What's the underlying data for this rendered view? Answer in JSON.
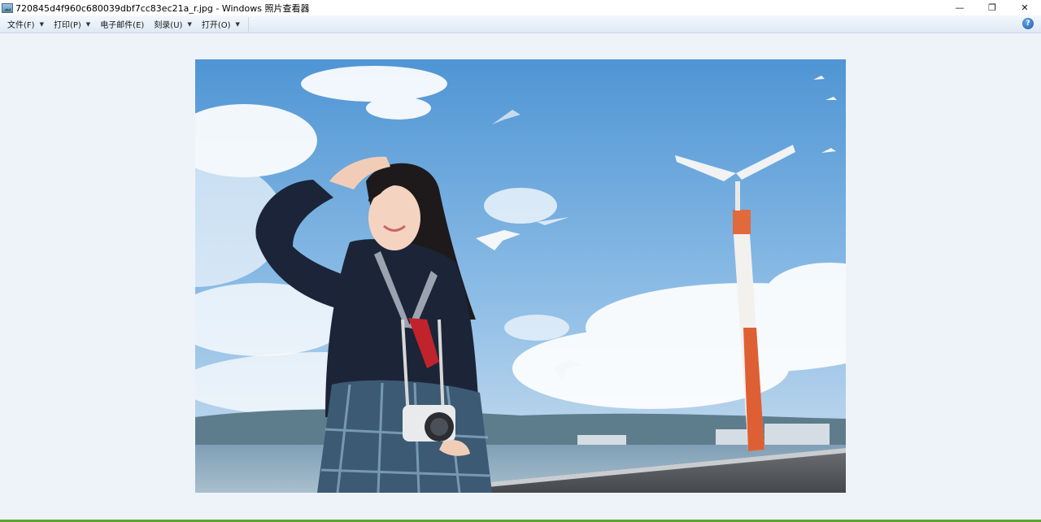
{
  "window": {
    "title": "720845d4f960c680039dbf7cc83ec21a_r.jpg - Windows 照片查看器",
    "minimize_glyph": "—",
    "restore_glyph": "❐",
    "close_glyph": "✕"
  },
  "menu": {
    "items": [
      {
        "label": "文件(F)"
      },
      {
        "label": "打印(P)"
      },
      {
        "label": "电子邮件(E)"
      },
      {
        "label": "刻录(U)"
      },
      {
        "label": "打开(O)"
      }
    ],
    "help_glyph": "?"
  },
  "icons": {
    "app": "photo-viewer-icon",
    "dropdown": "chevron-down-icon",
    "help": "help-icon"
  },
  "colors": {
    "viewer_background": "#eef3fa",
    "status_strip": "#5aa832"
  }
}
